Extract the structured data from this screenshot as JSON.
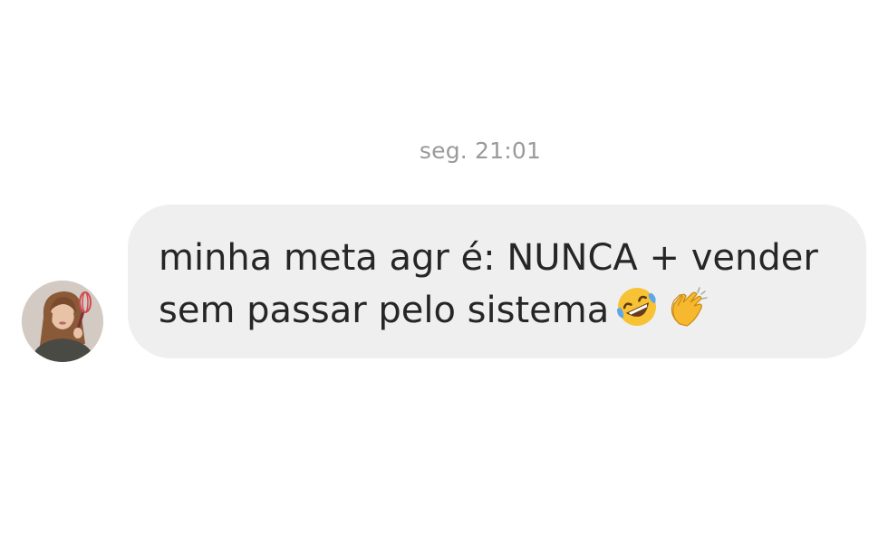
{
  "conversation": {
    "timestamp": "seg. 21:01",
    "message": {
      "line1": "minha meta agr é: NUNCA + vender",
      "line2": "sem passar pelo sistema",
      "emojis": [
        "rolling-on-floor-laughing-emoji",
        "clapping-hands-emoji"
      ]
    }
  },
  "colors": {
    "bubble_background": "#efefef",
    "text": "#262626",
    "timestamp": "#9a9a9a"
  }
}
